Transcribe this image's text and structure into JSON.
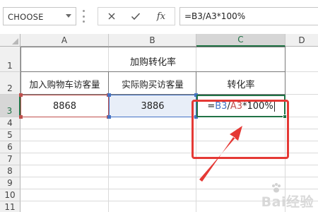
{
  "formula_bar": {
    "name_box": "CHOOSE",
    "formula": "=B3/A3*100%",
    "buttons": [
      {
        "icon": "cancel-x-icon"
      },
      {
        "icon": "enter-check-icon"
      },
      {
        "icon": "insert-function-icon",
        "label": "fx"
      }
    ]
  },
  "columns": [
    "A",
    "B",
    "C",
    "D"
  ],
  "rows": [
    "1",
    "2",
    "3",
    "4",
    "5",
    "6",
    "7",
    "8",
    "9",
    "10",
    "11"
  ],
  "cells": {
    "title": "加购转化率",
    "a2": "加入购物车访客量",
    "b2": "实际购买访客量",
    "c2": "转化率",
    "a3": "8868",
    "b3": "3886",
    "c3_formula": {
      "eq": "=",
      "ref1": "B3",
      "slash": "/",
      "ref2": "A3",
      "rest": "*100%"
    }
  },
  "colors": {
    "ref_b3": "#4472c4",
    "ref_a3": "#c0504d",
    "active_cell": "#217346",
    "highlight": "#e53935"
  },
  "watermark": "Bai经验"
}
